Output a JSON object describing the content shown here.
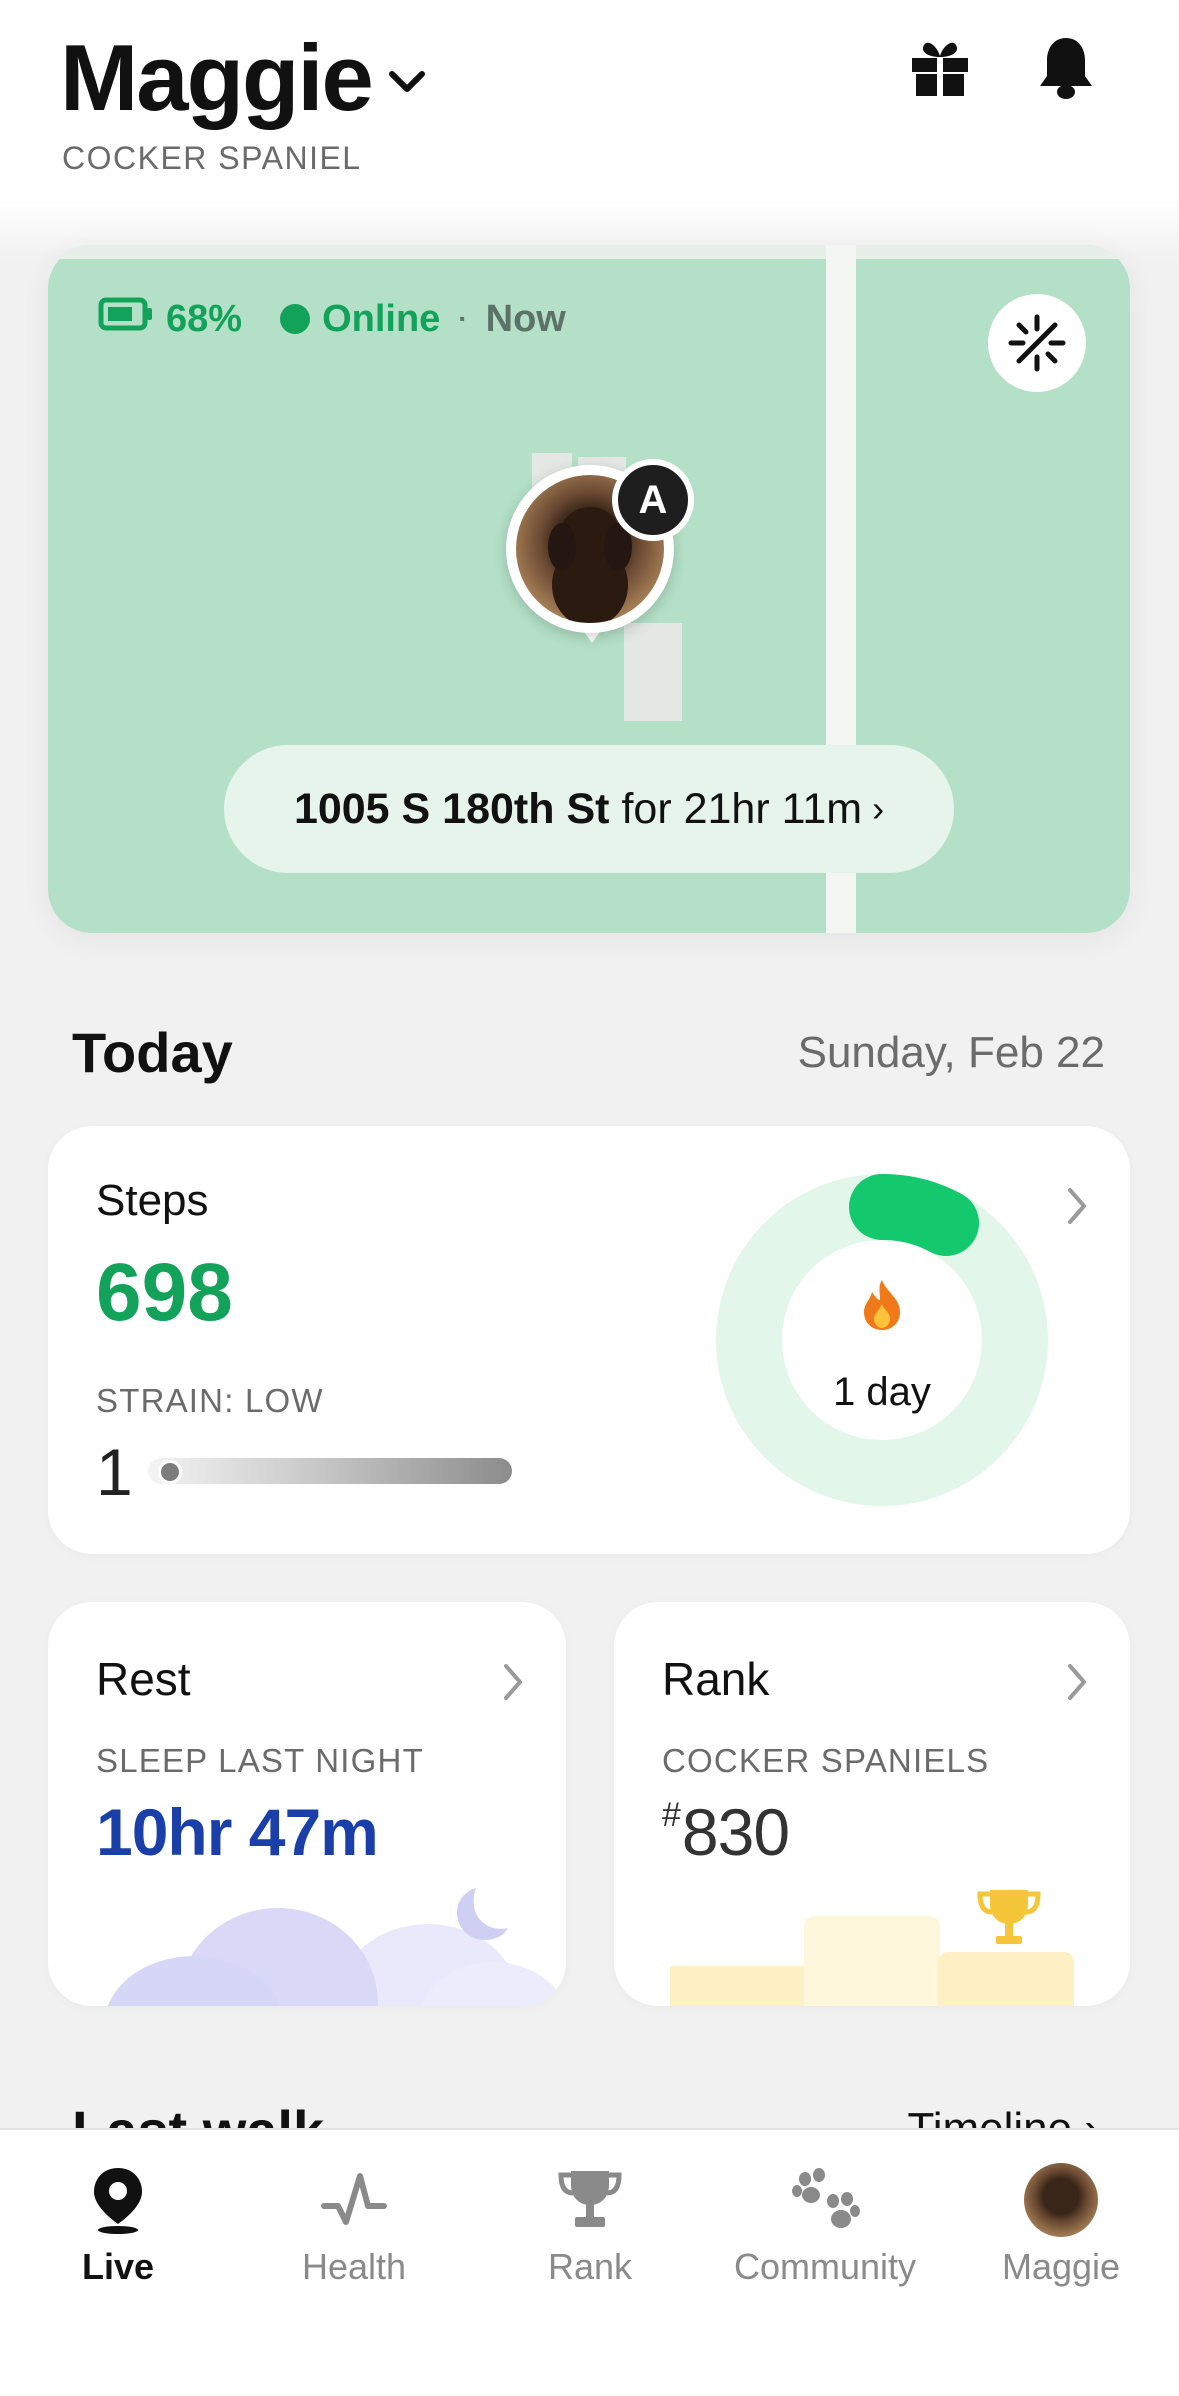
{
  "header": {
    "pet_name": "Maggie",
    "breed": "COCKER SPANIEL",
    "icons": [
      "chevron-down-icon",
      "gift-icon",
      "bell-icon"
    ]
  },
  "map": {
    "battery_pct": "68%",
    "status": "Online",
    "separator": "·",
    "last_seen": "Now",
    "pin_badge": "A",
    "address": "1005 S 180th St",
    "duration": "for 21hr 11m",
    "chevron": "›",
    "colors": {
      "map_bg": "#b4e0c7",
      "online": "#13a25a"
    }
  },
  "today": {
    "title": "Today",
    "date": "Sunday, Feb 22"
  },
  "steps": {
    "label": "Steps",
    "value": "698",
    "strain_label": "STRAIN: LOW",
    "strain_value": "1",
    "streak": "1 day",
    "goal_progress": 0.1,
    "color": "#13a25a"
  },
  "rest": {
    "title": "Rest",
    "subtitle": "SLEEP LAST NIGHT",
    "value": "10hr 47m",
    "color": "#1a3fa8"
  },
  "rank": {
    "title": "Rank",
    "subtitle": "COCKER SPANIELS",
    "hash": "#",
    "value": "830"
  },
  "peek": {
    "left": "Last walk",
    "right": "Timeline ›"
  },
  "nav": {
    "items": [
      {
        "label": "Live",
        "icon": "location-pin-icon"
      },
      {
        "label": "Health",
        "icon": "pulse-icon"
      },
      {
        "label": "Rank",
        "icon": "trophy-icon"
      },
      {
        "label": "Community",
        "icon": "paw-icon"
      },
      {
        "label": "Maggie",
        "icon": "avatar"
      }
    ]
  }
}
